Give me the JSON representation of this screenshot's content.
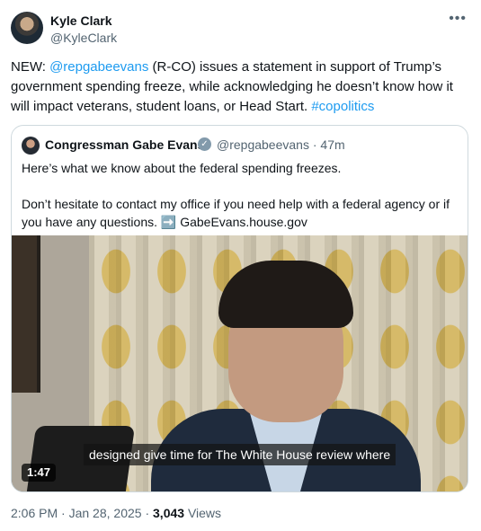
{
  "tweet": {
    "author_name": "Kyle Clark",
    "author_handle": "@KyleClark",
    "more_icon": "more-icon",
    "text_prefix": "NEW: ",
    "mention": "@repgabeevans",
    "text_middle": " (R-CO) issues a statement in support of Trump’s government spending freeze, while acknowledging he doesn’t know how it will impact veterans, student loans, or Head Start. ",
    "hashtag": "#copolitics"
  },
  "quote": {
    "author_name": "Congressman Gabe Evans",
    "verified_icon": "verified-badge-icon",
    "author_handle": "@repgabeevans",
    "separator": "·",
    "time_ago": "47m",
    "text_line1": "Here’s what we know about the federal spending freezes.",
    "text_line2": "Don’t hesitate to contact my office if you need help with a federal agency or if you have any questions.",
    "arrow_emoji": "➡️",
    "link_text": "GabeEvans.house.gov",
    "media": {
      "caption": "designed give time for The White House review where",
      "duration": "1:47"
    }
  },
  "footer": {
    "time": "2:06 PM",
    "separator": "·",
    "date": "Jan 28, 2025",
    "views_count": "3,043",
    "views_label": "Views"
  }
}
